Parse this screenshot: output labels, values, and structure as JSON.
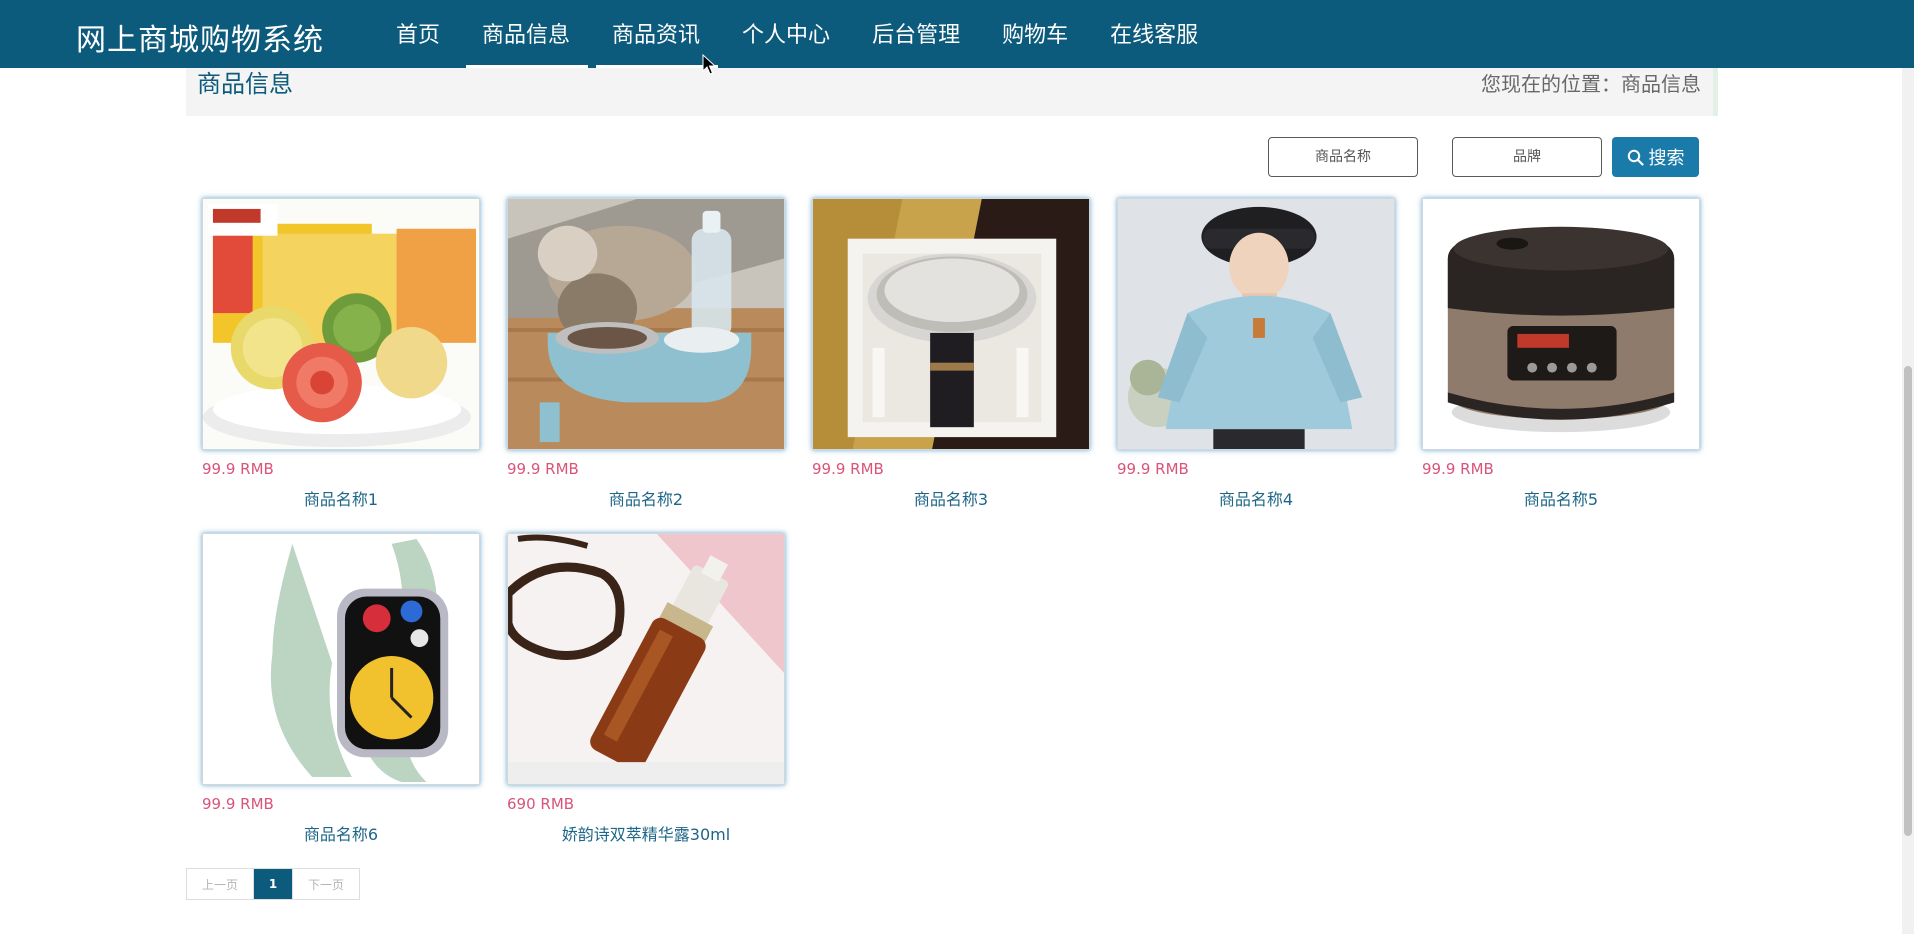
{
  "header": {
    "brand": "网上商城购物系统",
    "nav": [
      {
        "label": "首页",
        "active": false
      },
      {
        "label": "商品信息",
        "active": true
      },
      {
        "label": "商品资讯",
        "active": true
      },
      {
        "label": "个人中心",
        "active": false
      },
      {
        "label": "后台管理",
        "active": false
      },
      {
        "label": "购物车",
        "active": false
      },
      {
        "label": "在线客服",
        "active": false
      }
    ]
  },
  "breadcrumb": {
    "title": "商品信息",
    "location": "您现在的位置：商品信息"
  },
  "search": {
    "name_placeholder": "商品名称",
    "brand_placeholder": "品牌",
    "button_label": "搜索"
  },
  "products": [
    {
      "price": "99.9 RMB",
      "name": "商品名称1",
      "image_icon": "mooncake-image"
    },
    {
      "price": "99.9 RMB",
      "name": "商品名称2",
      "image_icon": "cat-feeder-image"
    },
    {
      "price": "99.9 RMB",
      "name": "商品名称3",
      "image_icon": "kitchen-scale-image"
    },
    {
      "price": "99.9 RMB",
      "name": "商品名称4",
      "image_icon": "hoodie-model-image"
    },
    {
      "price": "99.9 RMB",
      "name": "商品名称5",
      "image_icon": "rice-cooker-image"
    },
    {
      "price": "99.9 RMB",
      "name": "商品名称6",
      "image_icon": "smartwatch-image"
    },
    {
      "price": "690 RMB",
      "name": "娇韵诗双萃精华露30ml",
      "image_icon": "serum-bottle-image"
    }
  ],
  "pagination": {
    "prev": "上一页",
    "current": "1",
    "next": "下一页"
  },
  "colors": {
    "header_bg": "#0c5a7c",
    "price": "#d9537a",
    "product_name": "#1d6687",
    "search_button": "#1a7bab"
  }
}
